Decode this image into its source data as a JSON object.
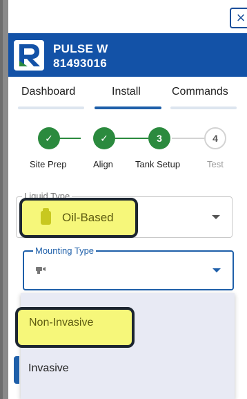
{
  "window": {
    "close_label": "×"
  },
  "header": {
    "device_name": "PULSE W",
    "device_id": "81493016",
    "brand_color": "#1352a7",
    "logo_icon": "r-logo-icon"
  },
  "tabs": [
    {
      "label": "Dashboard",
      "active": false
    },
    {
      "label": "Install",
      "active": true
    },
    {
      "label": "Commands",
      "active": false
    }
  ],
  "stepper": {
    "steps": [
      {
        "label": "Site Prep",
        "status": "done",
        "marker": "✓"
      },
      {
        "label": "Align",
        "status": "done",
        "marker": "✓"
      },
      {
        "label": "Tank Setup",
        "status": "current",
        "marker": "3"
      },
      {
        "label": "Test",
        "status": "pending",
        "marker": "4"
      }
    ],
    "complete_color": "#2b8a3e"
  },
  "form": {
    "liquid_type": {
      "label": "Liquid Type",
      "value": "Oil-Based",
      "icon": "oil-can-icon"
    },
    "mounting_type": {
      "label": "Mounting Type",
      "value": "",
      "icon": "sensor-icon"
    }
  },
  "mounting_menu": {
    "options": [
      {
        "label": "Non-Invasive",
        "highlighted": true
      },
      {
        "label": "Invasive",
        "highlighted": false
      }
    ]
  },
  "annotation_color": "#f6f77a"
}
